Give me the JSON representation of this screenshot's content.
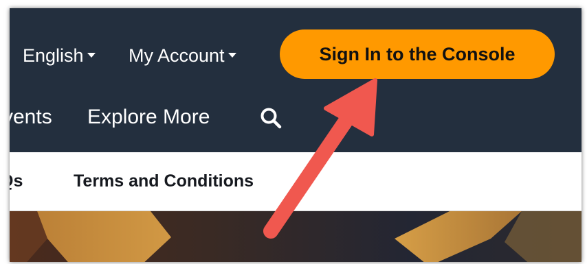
{
  "header": {
    "language_label": "English",
    "account_label": "My Account",
    "signin_label": "Sign In to the Console"
  },
  "nav": {
    "events_label": "vents",
    "explore_label": "Explore More"
  },
  "subnav": {
    "faqs_label": "Qs",
    "terms_label": "Terms and Conditions"
  },
  "icons": {
    "search": "search-icon",
    "dropdown": "caret-down-icon",
    "annotation": "red-arrow"
  },
  "colors": {
    "header_bg": "#232f3e",
    "signin_bg": "#ff9900",
    "arrow": "#f0584f"
  }
}
